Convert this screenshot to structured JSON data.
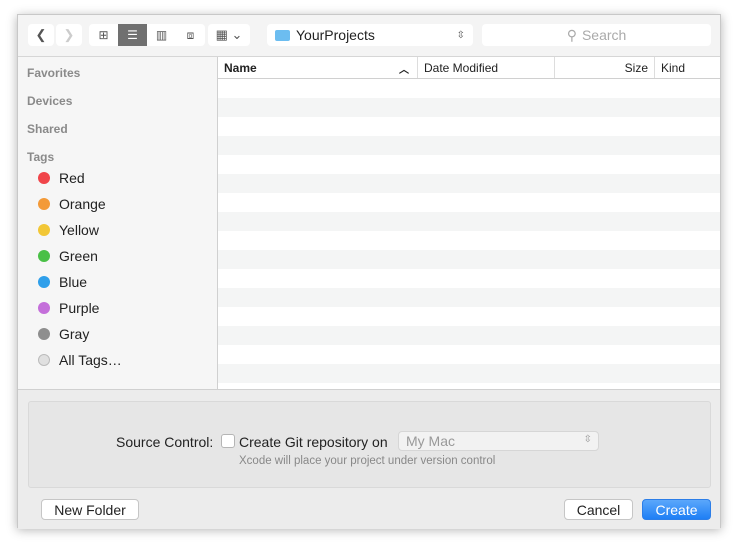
{
  "toolbar": {
    "location": "YourProjects",
    "search_placeholder": "Search"
  },
  "sidebar": {
    "sections": [
      "Favorites",
      "Devices",
      "Shared",
      "Tags"
    ],
    "tags": [
      {
        "label": "Red",
        "color": "#f0454a"
      },
      {
        "label": "Orange",
        "color": "#f39a38"
      },
      {
        "label": "Yellow",
        "color": "#f2c736"
      },
      {
        "label": "Green",
        "color": "#49c046"
      },
      {
        "label": "Blue",
        "color": "#2f9fea"
      },
      {
        "label": "Purple",
        "color": "#c46fda"
      },
      {
        "label": "Gray",
        "color": "#8e8e8e"
      },
      {
        "label": "All Tags…",
        "color": "#e0e0e0"
      }
    ]
  },
  "list": {
    "columns": [
      "Name",
      "Date Modified",
      "Size",
      "Kind"
    ]
  },
  "source_control": {
    "label": "Source Control:",
    "checkbox_label": "Create Git repository on",
    "checked": false,
    "target": "My Mac",
    "hint": "Xcode will place your project under version control"
  },
  "buttons": {
    "new_folder": "New Folder",
    "cancel": "Cancel",
    "create": "Create"
  },
  "colors": {
    "accent": "#3a8ff7"
  }
}
